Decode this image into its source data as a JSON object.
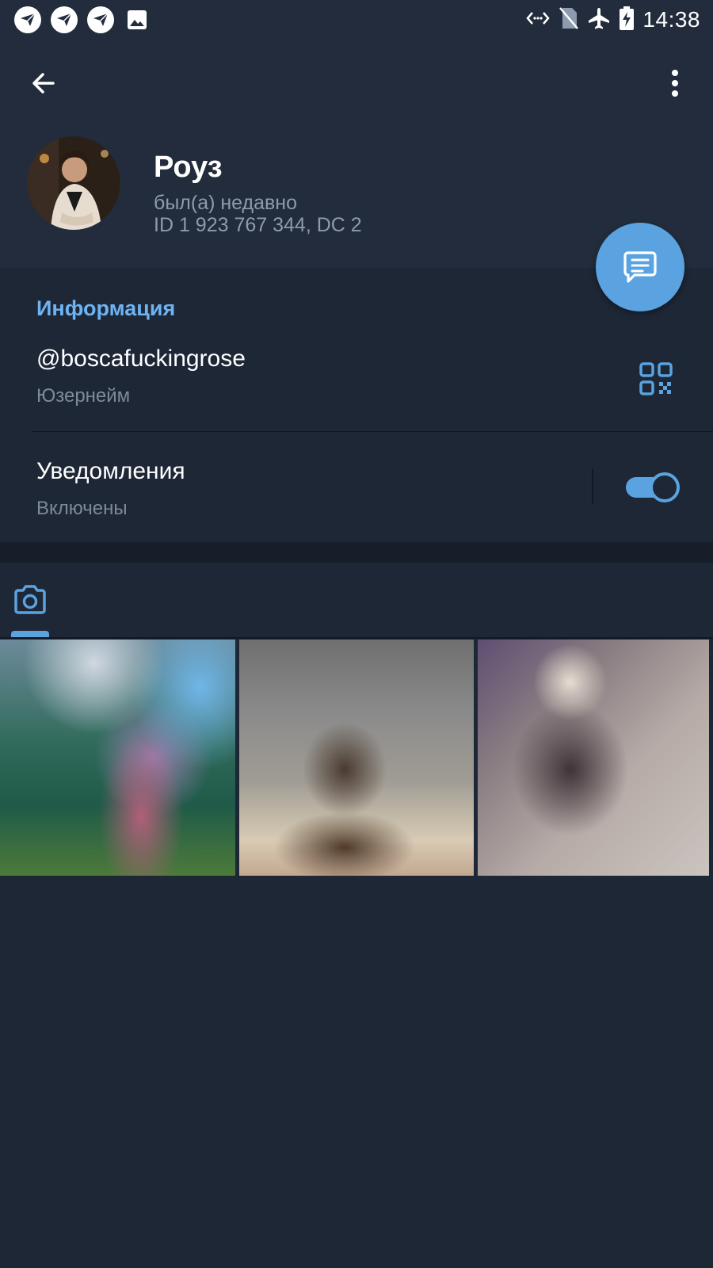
{
  "status_bar": {
    "time": "14:38",
    "left_icons": [
      "app-notification-icon",
      "app-notification-icon",
      "app-notification-icon",
      "image-icon"
    ],
    "right_icons": [
      "data-saver-icon",
      "no-sim-icon",
      "airplane-mode-icon",
      "battery-charging-icon"
    ]
  },
  "header": {
    "back_icon": "arrow-back-icon",
    "menu_icon": "more-vertical-icon",
    "name": "Роуз",
    "last_seen": "был(а) недавно",
    "id_line": "ID 1 923 767 344, DC 2",
    "fab_icon": "message-icon"
  },
  "info": {
    "section_title": "Информация",
    "username": "@boscafuckingrose",
    "username_caption": "Юзернейм",
    "qr_icon": "qr-code-icon",
    "notifications_label": "Уведомления",
    "notifications_state": "Включены",
    "notifications_enabled": true
  },
  "media": {
    "active_tab_icon": "camera-icon",
    "thumbnails": [
      "photo-1",
      "photo-2",
      "photo-3"
    ]
  },
  "colors": {
    "accent": "#5aa3e0",
    "section_title": "#6db3f2",
    "header_bg": "#222c3c",
    "body_bg": "#1e2736",
    "secondary_text": "#8d9bad"
  }
}
